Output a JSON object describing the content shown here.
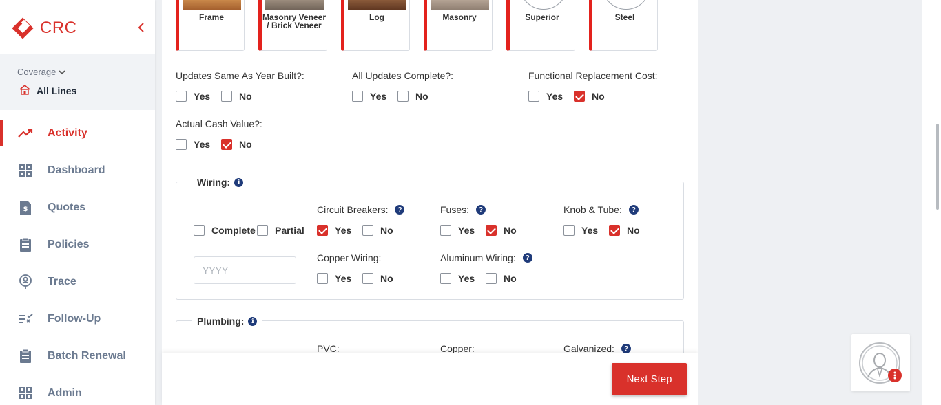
{
  "app": {
    "brand": "CRC"
  },
  "coverage": {
    "label": "Coverage",
    "value": "All Lines"
  },
  "nav": [
    {
      "label": "Activity",
      "icon": "trend-up-icon",
      "active": true
    },
    {
      "label": "Dashboard",
      "icon": "grid-icon"
    },
    {
      "label": "Quotes",
      "icon": "dollar-doc-icon"
    },
    {
      "label": "Policies",
      "icon": "clipboard-icon"
    },
    {
      "label": "Trace",
      "icon": "location-person-icon"
    },
    {
      "label": "Follow-Up",
      "icon": "list-check-icon"
    },
    {
      "label": "Batch Renewal",
      "icon": "clipboard-icon"
    },
    {
      "label": "Admin",
      "icon": "grid-icon"
    }
  ],
  "construction_tiles": [
    {
      "label": "Frame"
    },
    {
      "label": "Masonry Veneer / Brick Veneer"
    },
    {
      "label": "Log"
    },
    {
      "label": "Masonry"
    },
    {
      "label": "Superior"
    },
    {
      "label": "Steel"
    }
  ],
  "questions": {
    "updates_same": {
      "label": "Updates Same As Year Built?:",
      "yes": "Yes",
      "no": "No",
      "yes_checked": false,
      "no_checked": false
    },
    "all_updates": {
      "label": "All Updates Complete?:",
      "yes": "Yes",
      "no": "No",
      "yes_checked": false,
      "no_checked": false
    },
    "functional": {
      "label": "Functional Replacement Cost:",
      "yes": "Yes",
      "no": "No",
      "yes_checked": false,
      "no_checked": true
    },
    "acv": {
      "label": "Actual Cash Value?:",
      "yes": "Yes",
      "no": "No",
      "yes_checked": false,
      "no_checked": true
    }
  },
  "wiring": {
    "title": "Wiring:",
    "complete": "Complete",
    "partial": "Partial",
    "year_placeholder": "YYYY",
    "circuit": {
      "label": "Circuit Breakers:",
      "yes": "Yes",
      "no": "No",
      "yes_checked": true,
      "no_checked": false
    },
    "fuses": {
      "label": "Fuses:",
      "yes": "Yes",
      "no": "No",
      "yes_checked": false,
      "no_checked": true
    },
    "knob": {
      "label": "Knob & Tube:",
      "yes": "Yes",
      "no": "No",
      "yes_checked": false,
      "no_checked": true
    },
    "copper": {
      "label": "Copper Wiring:",
      "yes": "Yes",
      "no": "No",
      "yes_checked": false,
      "no_checked": false
    },
    "aluminum": {
      "label": "Aluminum Wiring:",
      "yes": "Yes",
      "no": "No",
      "yes_checked": false,
      "no_checked": false
    }
  },
  "plumbing": {
    "title": "Plumbing:",
    "pvc": "PVC:",
    "copper": "Copper:",
    "galvanized": "Galvanized:"
  },
  "footer": {
    "next_label": "Next Step"
  },
  "colors": {
    "accent": "#d9312b",
    "nav_text": "#6b7a90",
    "info_blue": "#1f3b7a"
  }
}
